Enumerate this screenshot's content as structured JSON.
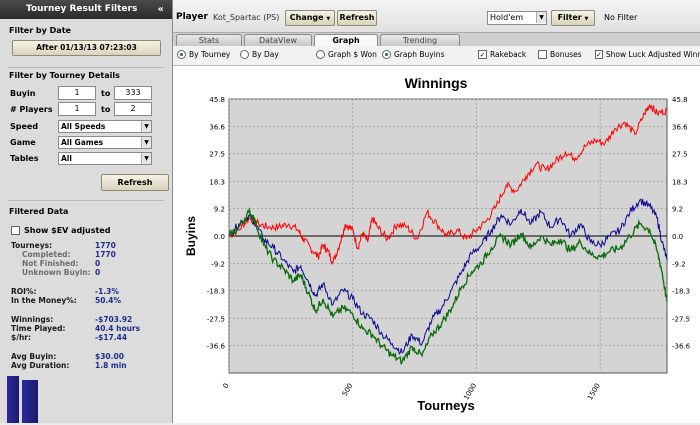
{
  "sidebar": {
    "title": "Tourney Result Filters",
    "collapse_glyph": "«",
    "filter_by_date": "Filter by Date",
    "date_button": "After 01/13/13 07:23:03",
    "filter_by_details": "Filter by Tourney Details",
    "buyin_label": "Buyin",
    "buyin_min": "1",
    "buyin_to": "to",
    "buyin_max": "333",
    "players_label": "# Players",
    "players_min": "1",
    "players_to": "to",
    "players_max": "2",
    "speed_label": "Speed",
    "speed_value": "All Speeds",
    "game_label": "Game",
    "game_value": "All Games",
    "tables_label": "Tables",
    "tables_value": "All",
    "refresh_button": "Refresh",
    "filtered_data": "Filtered Data",
    "show_ev_label": "Show $EV adjusted",
    "stats": {
      "tourneys_label": "Tourneys:",
      "tourneys_value": "1770",
      "completed_label": "Completed:",
      "completed_value": "1770",
      "not_finished_label": "Not Finished:",
      "not_finished_value": "0",
      "unknown_buyin_label": "Unknown Buyin:",
      "unknown_buyin_value": "0",
      "roi_label": "ROI%:",
      "roi_value": "-1.3%",
      "itm_label": "In the Money%:",
      "itm_value": "50.4%",
      "winnings_label": "Winnings:",
      "winnings_value": "-$703.92",
      "time_played_label": "Time Played:",
      "time_played_value": "40.4 hours",
      "hourly_label": "$/hr:",
      "hourly_value": "-$17.44",
      "avg_buyin_label": "Avg Buyin:",
      "avg_buyin_value": "$30.00",
      "avg_duration_label": "Avg Duration:",
      "avg_duration_value": "1.8 min"
    }
  },
  "toolbar": {
    "player_label": "Player",
    "player_value": "Kot_Spartac (PS)",
    "change_button": "Change",
    "refresh_button": "Refresh",
    "game_select": "Hold'em",
    "filter_button": "Filter",
    "no_filter": "No Filter"
  },
  "tabs": [
    {
      "label": "Stats"
    },
    {
      "label": "DataView"
    },
    {
      "label": "Graph"
    },
    {
      "label": "Trending"
    }
  ],
  "options": {
    "by_tourney": "By Tourney",
    "by_day": "By Day",
    "graph_won": "Graph $ Won",
    "graph_buyins": "Graph Buyins",
    "rakeback": "Rakeback",
    "bonuses": "Bonuses",
    "luck_adjusted": "Show Luck Adjusted Winnings"
  },
  "colors": {
    "red_series": "#ff0000",
    "blue_series": "#0a0a8c",
    "green_series": "#0a6b0a"
  },
  "chart_data": {
    "type": "line",
    "title": "Winnings",
    "xlabel": "Tourneys",
    "ylabel": "Buyins",
    "ylim": [
      -45.8,
      45.8
    ],
    "xlim": [
      0,
      1770
    ],
    "yticks": [
      "45.8",
      "36.6",
      "27.5",
      "18.3",
      "9.2",
      "0.0",
      "-9.2",
      "-18.3",
      "-27.5",
      "-36.6"
    ],
    "ytick_values": [
      45.8,
      36.6,
      27.5,
      18.3,
      9.2,
      0.0,
      -9.2,
      -18.3,
      -27.5,
      -36.6
    ],
    "xticks": [
      "0",
      "500",
      "1000",
      "1500"
    ],
    "xtick_values": [
      0,
      500,
      1000,
      1500
    ],
    "grid": true,
    "series": [
      {
        "color": "#ff0000",
        "x": [
          0,
          40,
          80,
          120,
          160,
          200,
          240,
          280,
          300,
          330,
          360,
          380,
          400,
          420,
          450,
          470,
          500,
          520,
          540,
          560,
          580,
          600,
          640,
          680,
          720,
          760,
          800,
          840,
          880,
          920,
          960,
          1000,
          1040,
          1080,
          1120,
          1160,
          1200,
          1240,
          1280,
          1320,
          1360,
          1400,
          1440,
          1480,
          1520,
          1560,
          1600,
          1640,
          1680,
          1700,
          1730,
          1770
        ],
        "values": [
          0,
          2,
          6,
          4,
          3,
          3,
          4,
          2,
          -1,
          -4,
          -7,
          -3,
          -5,
          -9,
          -2,
          4,
          2,
          -4,
          1,
          -2,
          6,
          3,
          -1,
          4,
          3,
          -1,
          8,
          4,
          0,
          2,
          -1,
          2,
          5,
          10,
          17,
          15,
          20,
          24,
          22,
          25,
          28,
          26,
          30,
          32,
          31,
          36,
          38,
          34,
          41,
          44,
          41,
          42
        ]
      },
      {
        "color": "#0a0a8c",
        "x": [
          0,
          40,
          80,
          100,
          140,
          180,
          220,
          260,
          290,
          320,
          350,
          380,
          420,
          460,
          500,
          540,
          580,
          620,
          660,
          700,
          740,
          780,
          820,
          860,
          900,
          940,
          980,
          1020,
          1060,
          1100,
          1140,
          1180,
          1220,
          1260,
          1300,
          1340,
          1380,
          1420,
          1460,
          1500,
          1540,
          1580,
          1620,
          1660,
          1700,
          1730,
          1750,
          1770
        ],
        "values": [
          0,
          4,
          7,
          5,
          -1,
          -4,
          -8,
          -12,
          -10,
          -15,
          -20,
          -16,
          -23,
          -18,
          -21,
          -26,
          -28,
          -33,
          -36,
          -39,
          -33,
          -36,
          -28,
          -24,
          -18,
          -12,
          -6,
          -3,
          2,
          7,
          4,
          9,
          4,
          8,
          3,
          6,
          0,
          4,
          -2,
          -3,
          0,
          2,
          8,
          12,
          10,
          6,
          -2,
          -8
        ]
      },
      {
        "color": "#0a6b0a",
        "x": [
          0,
          40,
          80,
          100,
          140,
          180,
          220,
          260,
          290,
          320,
          350,
          380,
          420,
          460,
          500,
          540,
          580,
          620,
          660,
          700,
          740,
          780,
          820,
          860,
          900,
          940,
          980,
          1020,
          1060,
          1100,
          1140,
          1180,
          1220,
          1260,
          1300,
          1340,
          1380,
          1420,
          1460,
          1500,
          1540,
          1580,
          1620,
          1660,
          1700,
          1730,
          1750,
          1770
        ],
        "values": [
          0,
          3,
          8,
          6,
          -3,
          -8,
          -11,
          -15,
          -13,
          -19,
          -25,
          -21,
          -27,
          -24,
          -26,
          -31,
          -33,
          -37,
          -40,
          -42,
          -37,
          -40,
          -33,
          -29,
          -24,
          -17,
          -12,
          -9,
          -4,
          0,
          -3,
          1,
          -4,
          0,
          -3,
          -1,
          -5,
          -2,
          -6,
          -7,
          -5,
          -4,
          0,
          4,
          2,
          -5,
          -12,
          -22
        ]
      }
    ]
  }
}
